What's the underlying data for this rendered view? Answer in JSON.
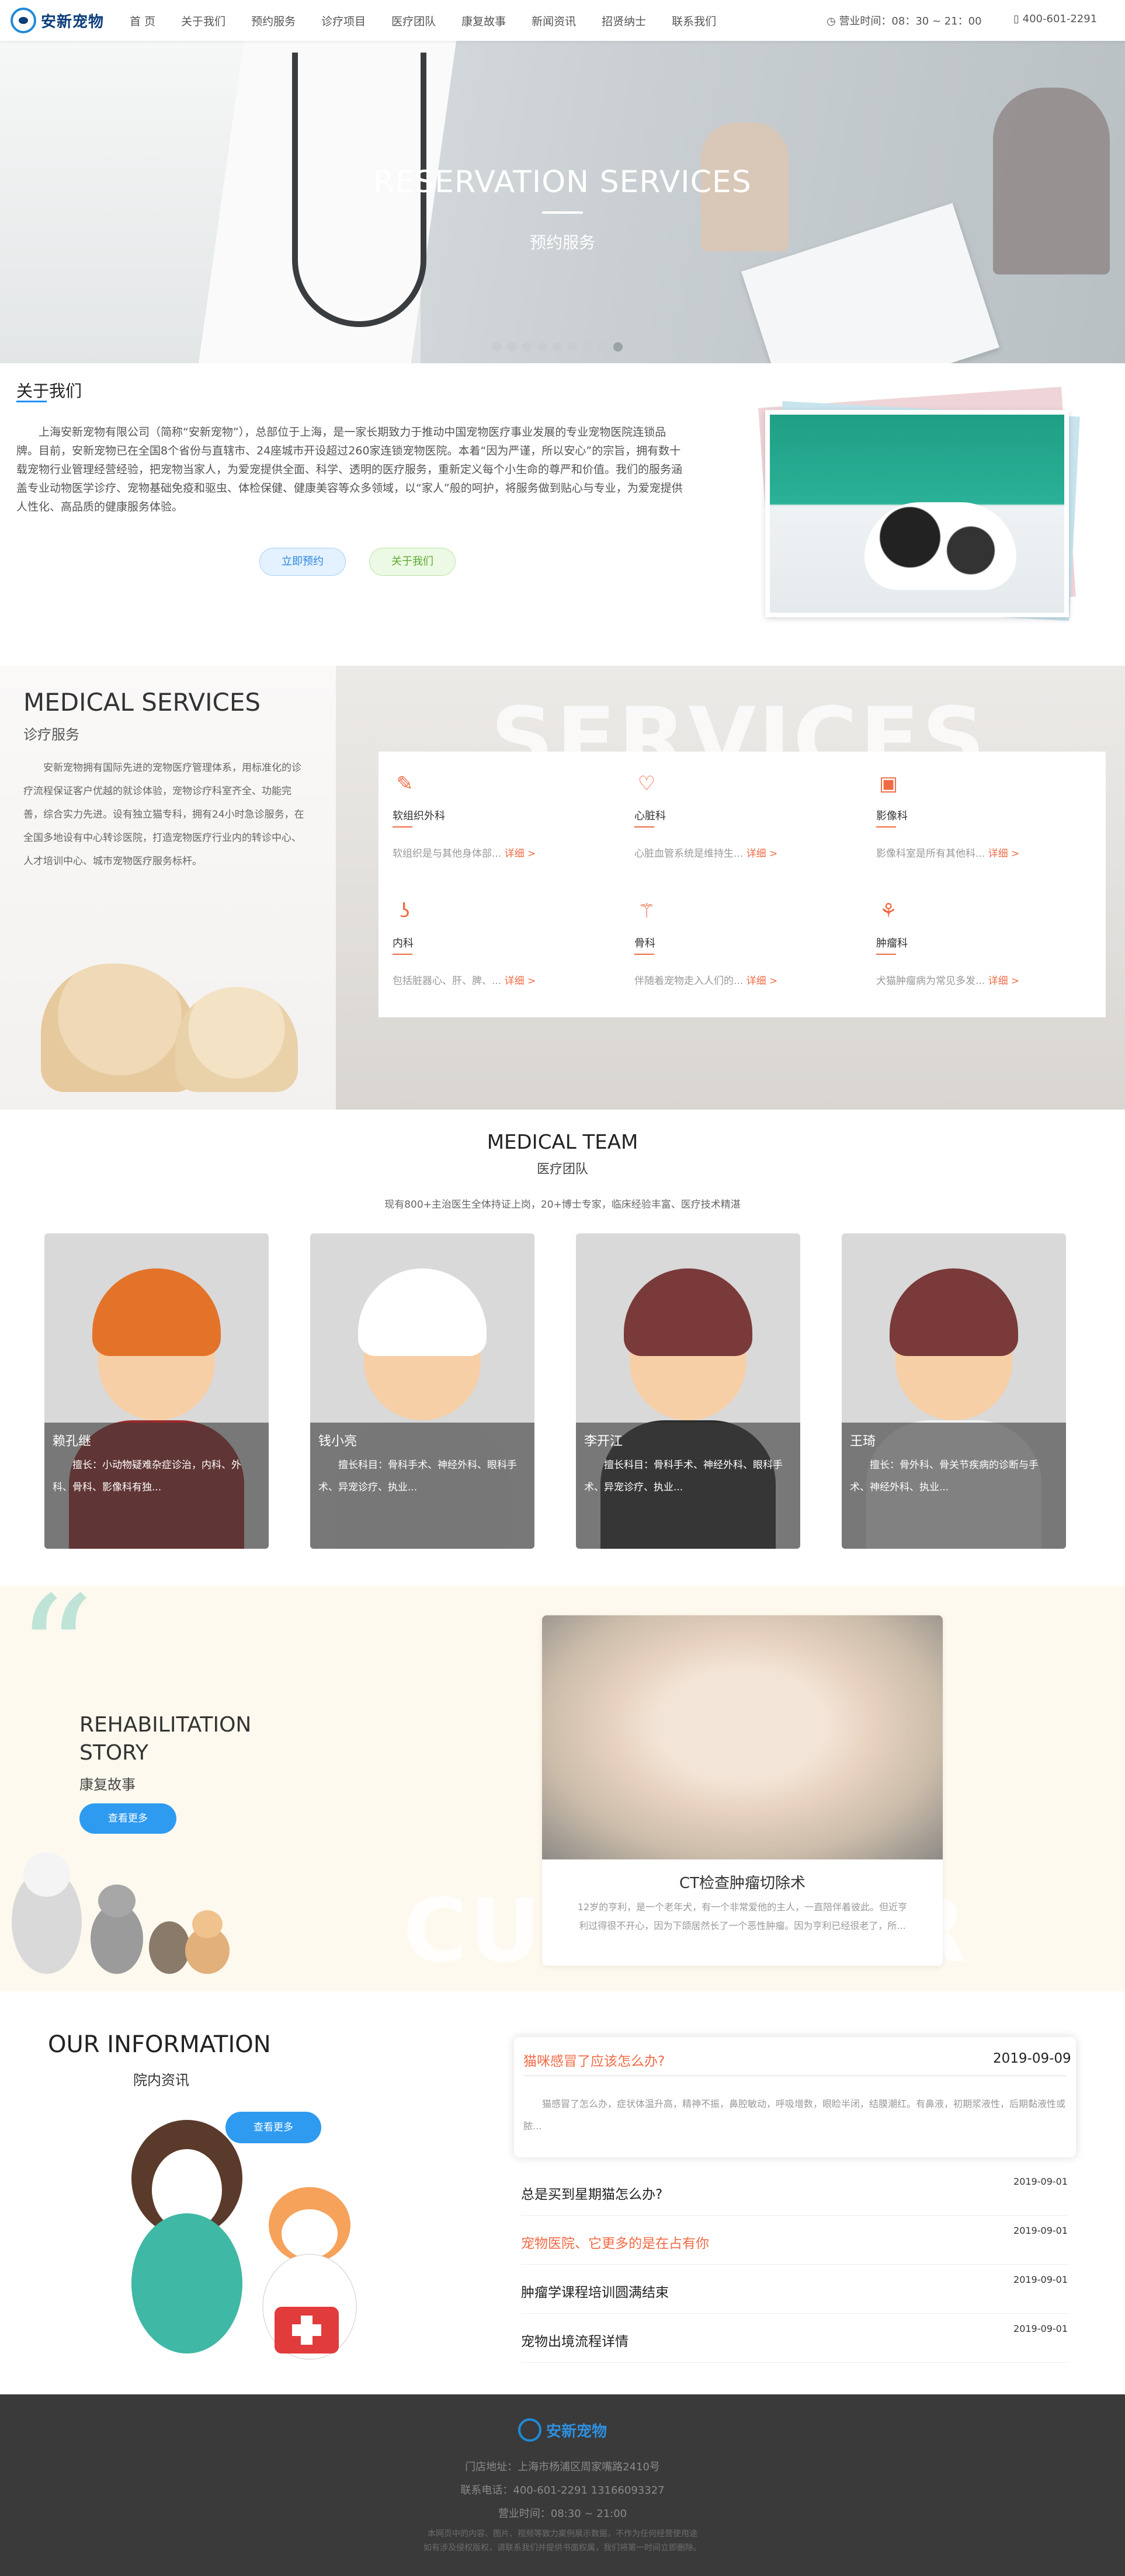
{
  "header": {
    "logo_text": "安新宠物",
    "nav": [
      "首 页",
      "关于我们",
      "预约服务",
      "诊疗项目",
      "医疗团队",
      "康复故事",
      "新闻资讯",
      "招贤纳士",
      "联系我们"
    ],
    "hours": "营业时间：08：30 ~ 21：00",
    "phone": "400-601-2291"
  },
  "hero": {
    "title": "RESERVATION SERVICES",
    "subtitle": "预约服务",
    "slide_count": 9,
    "active_slide": 9
  },
  "about": {
    "title": "关于我们",
    "text": "上海安新宠物有限公司（简称“安新宠物”），总部位于上海，是一家长期致力于推动中国宠物医疗事业发展的专业宠物医院连锁品牌。目前，安新宠物已在全国8个省份与直辖市、24座城市开设超过260家连锁宠物医院。本着“因为严谨，所以安心”的宗旨，拥有数十载宠物行业管理经营经验，把宠物当家人，为爱宠提供全面、科学、透明的医疗服务，重新定义每个小生命的尊严和价值。我们的服务涵盖专业动物医学诊疗、宠物基础免疫和驱虫、体检保健、健康美容等众多领域，以“家人”般的呵护，将服务做到贴心与专业，为爱宠提供人性化、高品质的健康服务体验。",
    "btn_book": "立即预约",
    "btn_about": "关于我们"
  },
  "medical": {
    "title": "MEDICAL SERVICES",
    "subtitle": "诊疗服务",
    "text": "安新宠物拥有国际先进的宠物医疗管理体系，用标准化的诊疗流程保证客户优越的就诊体验，宠物诊疗科室齐全、功能完善，综合实力先进。设有独立猫专科，拥有24小时急诊服务，在全国多地设有中心转诊医院，打造宠物医疗行业内的转诊中心、人才培训中心、城市宠物医疗服务标杆。",
    "bg_word": "SERVICES",
    "more_label": "详细 >",
    "services": [
      {
        "icon": "scalpel-icon",
        "glyph": "✎",
        "name": "软组织外科",
        "desc": "软组织是与其他身体部..."
      },
      {
        "icon": "heart-icon",
        "glyph": "♡",
        "name": "心脏科",
        "desc": "心脏血管系统是维持生..."
      },
      {
        "icon": "imaging-icon",
        "glyph": "▣",
        "name": "影像科",
        "desc": "影像科室是所有其他科..."
      },
      {
        "icon": "stomach-icon",
        "glyph": "ʖ",
        "name": "内科",
        "desc": "包括脏器心、肝、脾、..."
      },
      {
        "icon": "bone-icon",
        "glyph": "⚚",
        "name": "骨科",
        "desc": "伴随着宠物走入人们的..."
      },
      {
        "icon": "molecule-icon",
        "glyph": "⚘",
        "name": "肿瘤科",
        "desc": "犬猫肿瘤病为常见多发..."
      }
    ]
  },
  "team": {
    "title": "MEDICAL TEAM",
    "subtitle": "医疗团队",
    "desc": "现有800+主治医生全体持证上岗，20+博士专家，临床经验丰富、医疗技术精湛",
    "members": [
      {
        "name": "赖孔继",
        "desc": "擅长：小动物疑难杂症诊治，内科、外科、骨科、影像科有独...",
        "hair": "#e4732a",
        "body": "#9c2a2a"
      },
      {
        "name": "钱小亮",
        "desc": "擅长科目：骨科手术、神经外科、眼科手术、异宠诊疗、执业...",
        "hair": "#ffffff",
        "body": "#d7d7d7"
      },
      {
        "name": "李开江",
        "desc": "擅长科目：骨科手术、神经外科、眼科手术、异宠诊疗、执业...",
        "hair": "#7a3a3a",
        "body": "#2e2e2e"
      },
      {
        "name": "王琦",
        "desc": "擅长：骨外科、骨关节疾病的诊断与手术、神经外科、执业...",
        "hair": "#7a3a3a",
        "body": "#f2f2f2"
      }
    ]
  },
  "rehab": {
    "title": "REHABILITATION STORY",
    "subtitle": "康复故事",
    "btn": "查看更多",
    "card_title": "CT检查肿瘤切除术",
    "card_desc": "12岁的亨利，是一个老年犬，有一个非常爱他的主人，一直陪伴着彼此。但近亨利过得很不开心，因为下颌居然长了一个恶性肿瘤。因为亨利已经很老了，所...",
    "bg_word": "CUSTOMER"
  },
  "info": {
    "title": "OUR INFORMATION",
    "subtitle": "院内资讯",
    "btn": "查看更多",
    "featured": {
      "title": "猫咪感冒了应该怎么办?",
      "date": "2019-09-09",
      "desc": "猫感冒了怎么办，症状体温升高，精神不振，鼻腔敏动，呼吸增数，眼睑半闭，结膜潮红。有鼻液，初期浆液性，后期黏液性或脓..."
    },
    "items": [
      {
        "title": "总是买到星期猫怎么办?",
        "date": "2019-09-01",
        "hot": false
      },
      {
        "title": "宠物医院、它更多的是在占有你",
        "date": "2019-09-01",
        "hot": true
      },
      {
        "title": "肿瘤学课程培训圆满结束",
        "date": "2019-09-01",
        "hot": false
      },
      {
        "title": "宠物出境流程详情",
        "date": "2019-09-01",
        "hot": false
      }
    ]
  },
  "footer": {
    "logo_text": "安新宠物",
    "address": "门店地址：上海市杨浦区周家嘴路2410号",
    "phone": "联系电话：400-601-2291 13166093327",
    "hours": "营业时间：08:30 ~ 21:00",
    "note1": "本网页中的内容、图片、视频等致力案例展示数据，不作为任何经营使用途",
    "note2": "如有涉及侵权版权，请联系我们并提供书面权属，我们将第一时间立即删除。"
  },
  "colors": {
    "accent": "#f06b45",
    "blue": "#2f9bf0",
    "mint": "#bfe4d7",
    "footer_bg": "#3a3a3a"
  }
}
